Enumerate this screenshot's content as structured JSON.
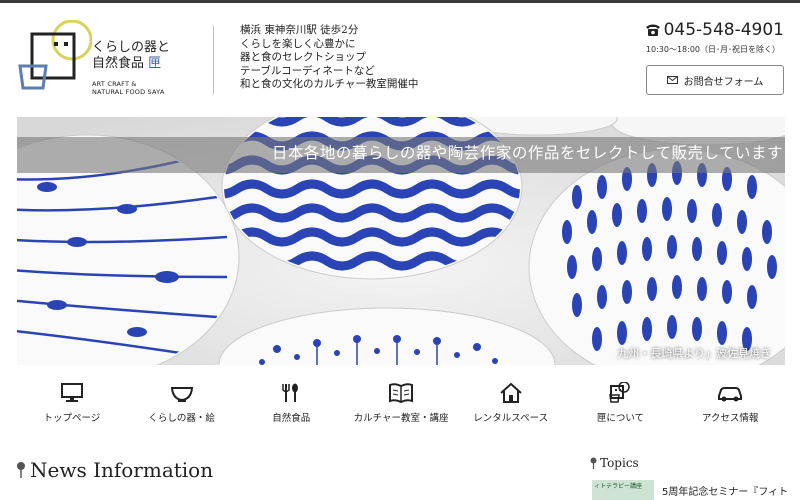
{
  "header": {
    "logo": {
      "title_line1": "くらしの器と",
      "title_line2": "自然食品",
      "title_mark": "匣",
      "en_line1": "ART CRAFT &",
      "en_line2": "NATURAL FOOD SAYA",
      "accent_color": "#d8d45a",
      "blue_color": "#5b7fb0"
    },
    "tagline": [
      "横浜 東神奈川駅 徒歩2分",
      "くらしを楽しく心豊かに",
      "器と食のセレクトショップ",
      "テーブルコーディネートなど",
      "和と食の文化のカルチャー教室開催中"
    ],
    "phone": "045-548-4901",
    "hours": "10:30～18:00（日･月･祝日を除く）",
    "contact_label": "お問合せフォーム"
  },
  "hero": {
    "banner_text": "日本各地の暮らしの器や陶芸作家の作品をセレクトして販売しています",
    "caption": "九州・長崎県より」波佐見焼き",
    "pattern_color": "#2a44b5"
  },
  "nav": [
    {
      "label": "トップページ",
      "icon": "monitor-icon"
    },
    {
      "label": "くらしの器・絵",
      "icon": "bowl-icon"
    },
    {
      "label": "自然食品",
      "icon": "cutlery-icon"
    },
    {
      "label": "カルチャー教室・講座",
      "icon": "book-icon"
    },
    {
      "label": "レンタルスペース",
      "icon": "house-icon"
    },
    {
      "label": "匣について",
      "icon": "shop-icon"
    },
    {
      "label": "アクセス情報",
      "icon": "car-icon"
    }
  ],
  "news": {
    "title": "News Information"
  },
  "topics": {
    "title": "Topics",
    "thumb_text": "ィトテラピー講座",
    "item_text": "5周年記念セミナー『フィト"
  }
}
